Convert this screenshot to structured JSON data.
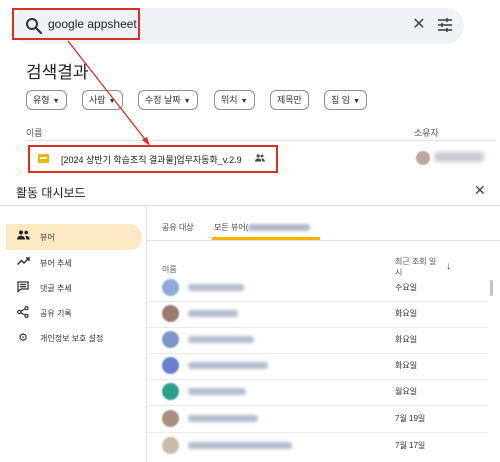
{
  "search": {
    "query": "google appsheet",
    "clear_icon": "close-icon",
    "tune_icon": "tune-icon"
  },
  "results": {
    "title": "검색결과",
    "filters": [
      "유형",
      "사람",
      "수정 날짜",
      "위치",
      "제목만",
      "칩 임"
    ],
    "columns": {
      "name": "이름",
      "owner": "소유자"
    },
    "file": {
      "name": "[2024 상반기 학습조직 결과물]업무자동화_v.2.9",
      "type_icon": "slides-file-icon",
      "shared_icon": "people-icon"
    }
  },
  "dashboard": {
    "title": "활동 대시보드",
    "close_icon": "close-icon",
    "sidebar": [
      {
        "label": "뷰어",
        "icon": "people-icon",
        "active": true
      },
      {
        "label": "뷰어 추세",
        "icon": "trending-up-icon",
        "active": false
      },
      {
        "label": "댓글 추세",
        "icon": "comment-icon",
        "active": false
      },
      {
        "label": "공유 기록",
        "icon": "share-icon",
        "active": false
      },
      {
        "label": "개인정보 보호 설정",
        "icon": "gear-icon",
        "active": false
      }
    ],
    "tabs": [
      {
        "label": "공유 대상",
        "active": false
      },
      {
        "label": "모든 뷰어(",
        "active": true
      }
    ],
    "columns": {
      "name": "이름",
      "last_viewed_line1": "최근 조회 일",
      "last_viewed_line2": "시"
    },
    "viewers": [
      {
        "last_viewed": "수요일",
        "avatar_color": "#8fa9d8"
      },
      {
        "last_viewed": "화요일",
        "avatar_color": "#9a7a72"
      },
      {
        "last_viewed": "화요일",
        "avatar_color": "#7f96c8"
      },
      {
        "last_viewed": "화요일",
        "avatar_color": "#6a7fd0"
      },
      {
        "last_viewed": "월요일",
        "avatar_color": "#2f9c8c"
      },
      {
        "last_viewed": "7월 19일",
        "avatar_color": "#a88f82"
      },
      {
        "last_viewed": "7월 17일",
        "avatar_color": "#c8bca8"
      }
    ]
  }
}
